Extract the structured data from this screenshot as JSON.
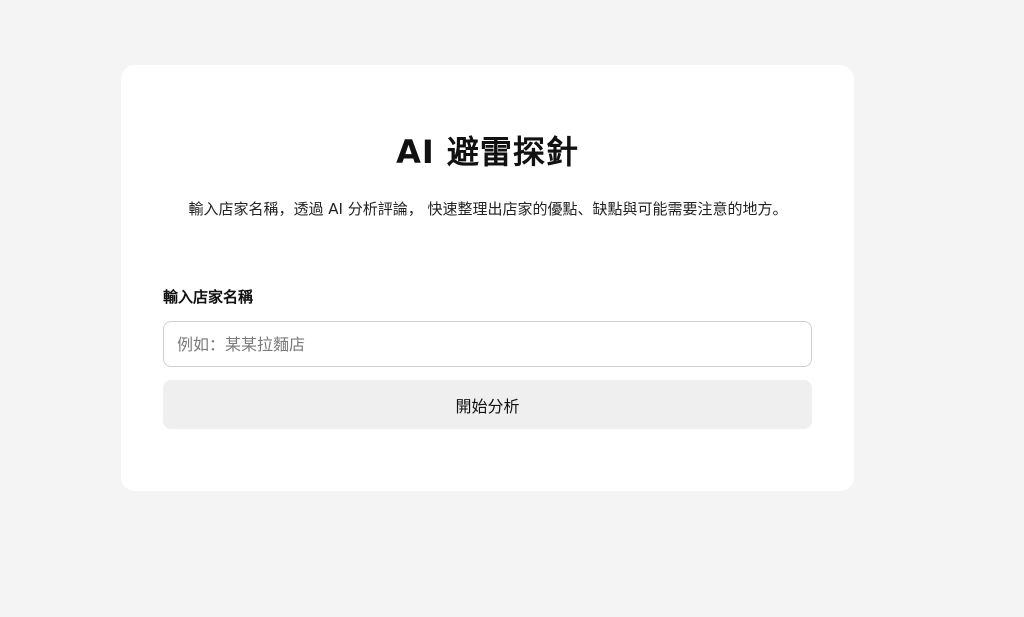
{
  "app": {
    "title": "AI 避雷探針",
    "description": "輸入店家名稱，透過 AI 分析評論， 快速整理出店家的優點、缺點與可能需要注意的地方。"
  },
  "form": {
    "label": "輸入店家名稱",
    "input_value": "",
    "placeholder": "例如：某某拉麵店",
    "submit_label": "開始分析"
  }
}
